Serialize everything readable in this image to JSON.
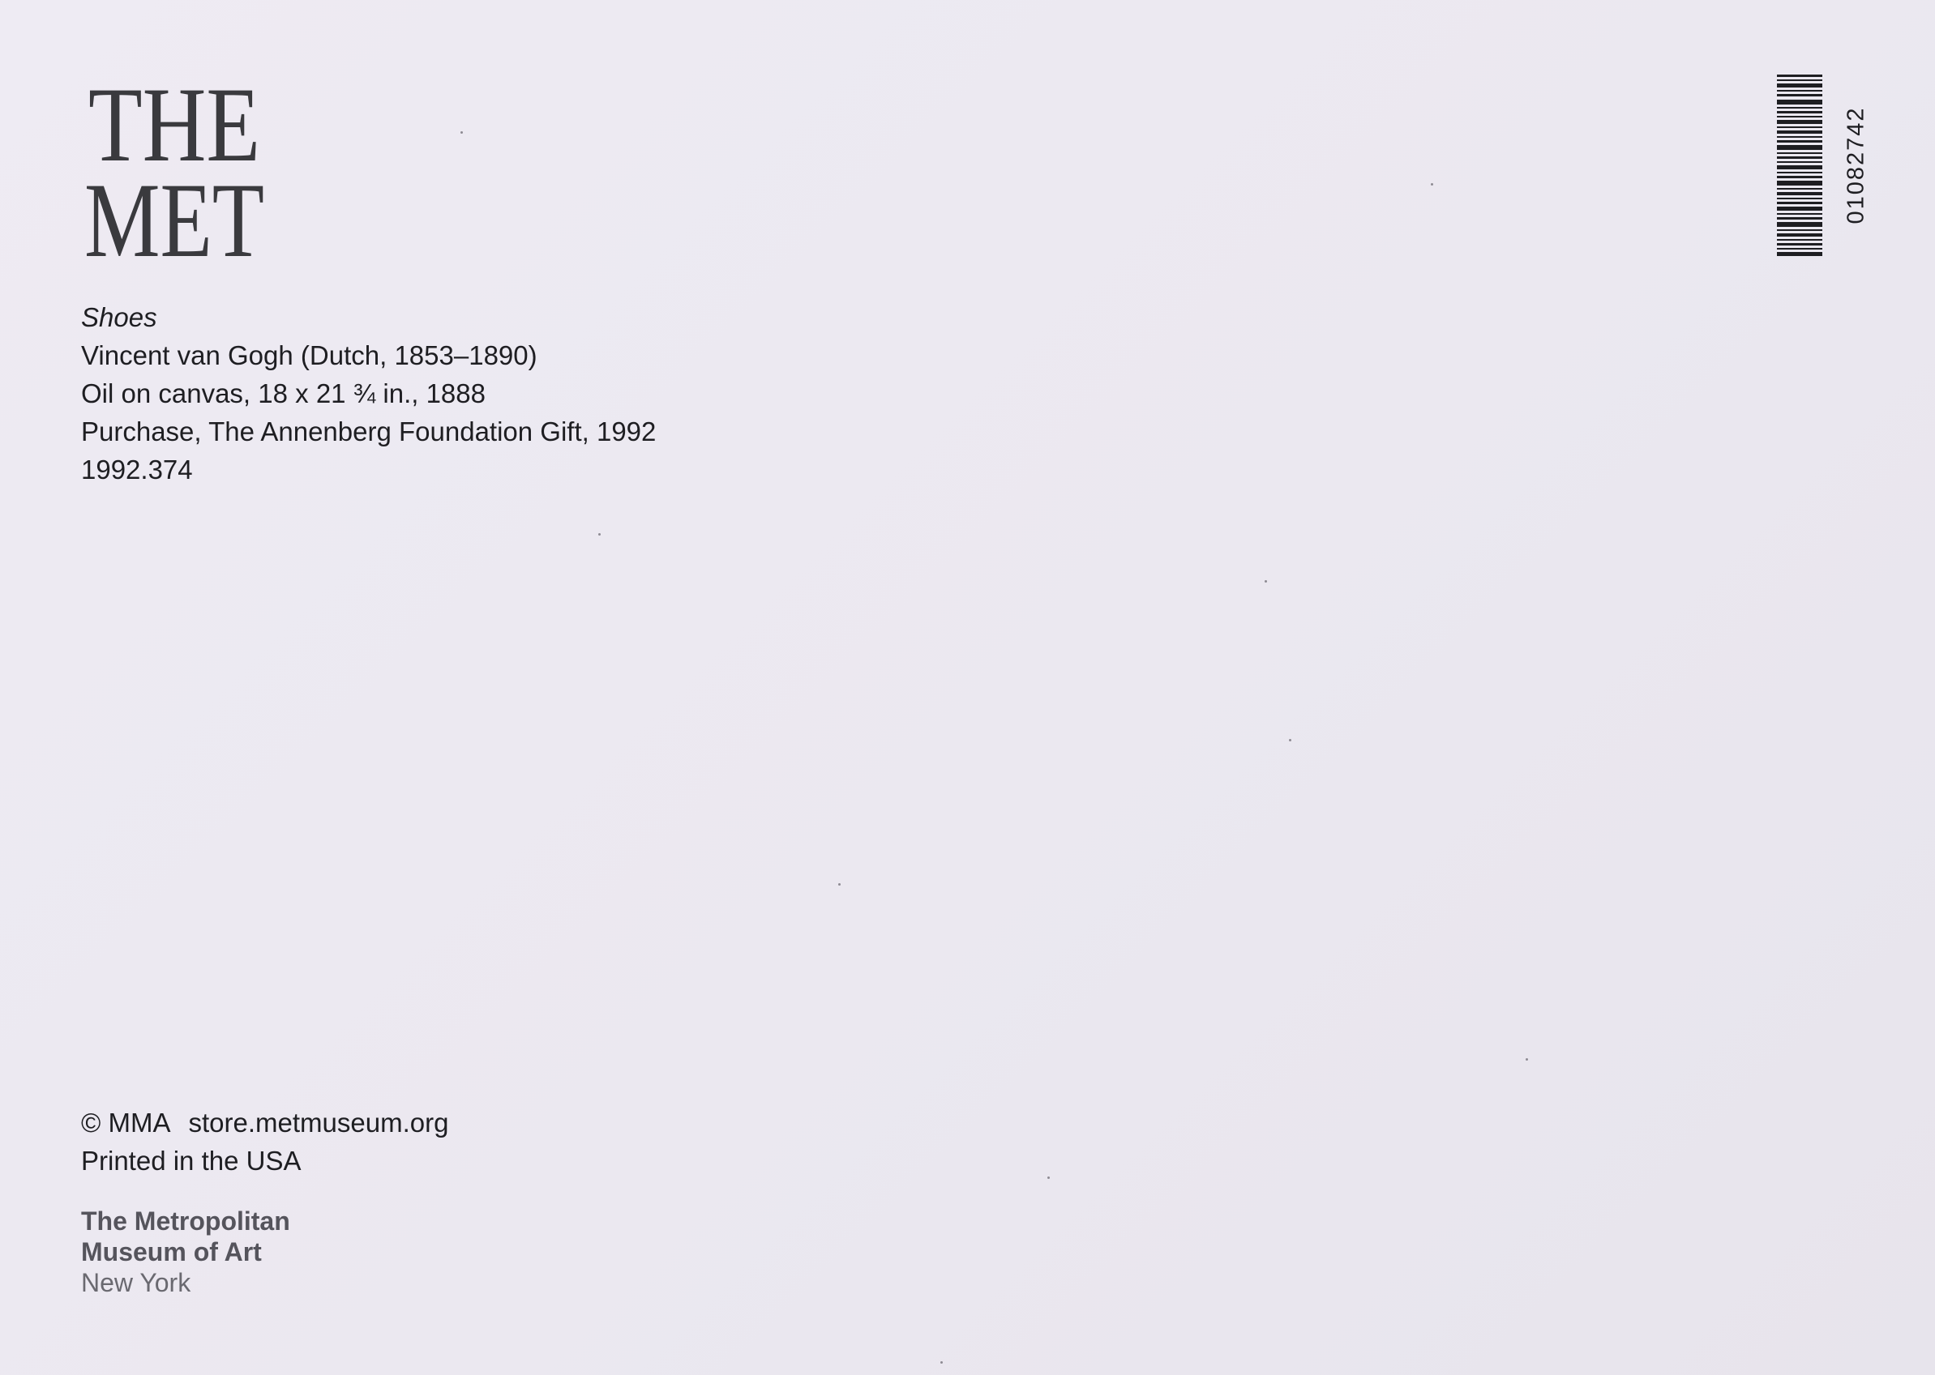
{
  "logo": {
    "line1": "THE",
    "line2": "MET",
    "color": "#3a3a3e"
  },
  "caption": {
    "title": "Shoes",
    "artist": "Vincent van Gogh (Dutch, 1853–1890)",
    "medium": "Oil on canvas, 18 x 21 ¾ in., 1888",
    "credit": "Purchase, The Annenberg Foundation Gift, 1992",
    "accession": "1992.374"
  },
  "footer": {
    "copyright": "© MMA",
    "website": "store.metmuseum.org",
    "printed": "Printed in the USA"
  },
  "institution": {
    "line1": "The Metropolitan",
    "line2": "Museum of Art",
    "city": "New York"
  },
  "barcode": {
    "number": "01082742"
  },
  "colors": {
    "paper": "#ebe8f0",
    "text": "#1e1e22",
    "institution_text": "#55545c"
  }
}
